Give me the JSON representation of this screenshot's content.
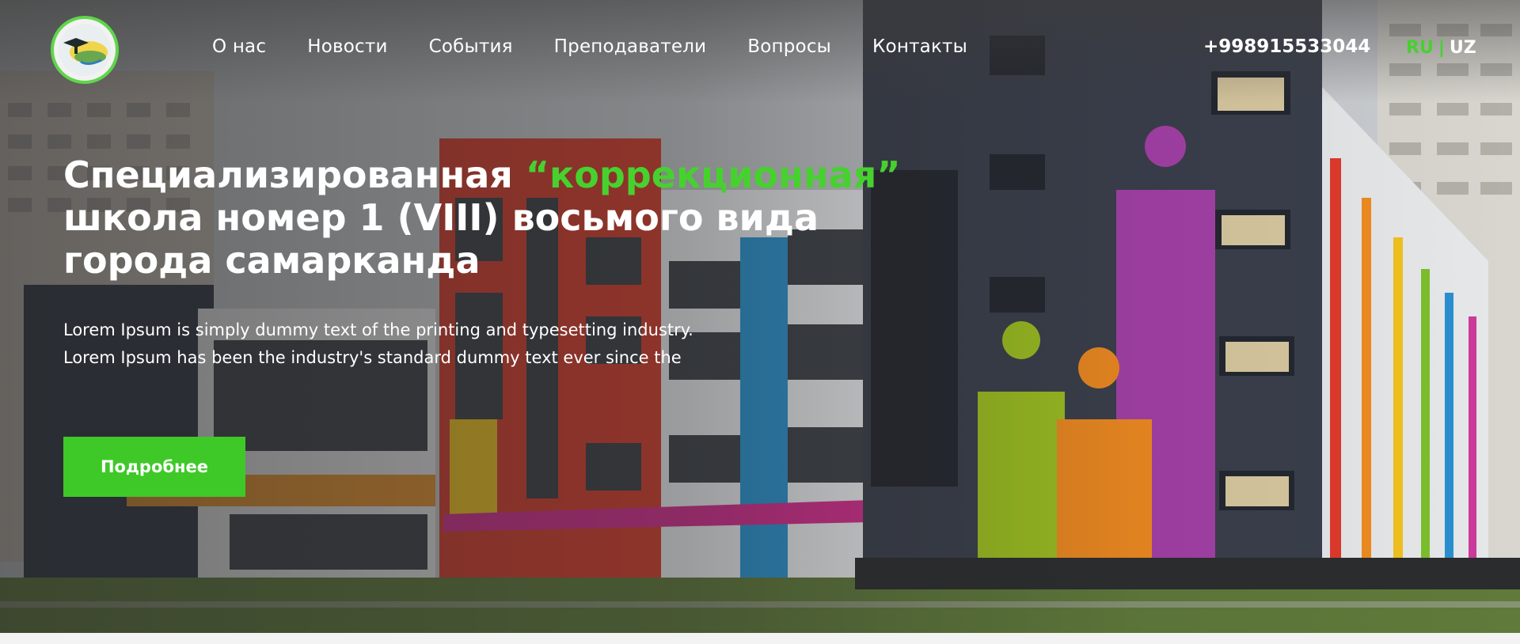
{
  "header": {
    "nav": [
      "О нас",
      "Новости",
      "События",
      "Преподаватели",
      "Вопросы",
      "Контакты"
    ],
    "phone": "+998915533044",
    "lang": {
      "ru": "RU",
      "sep": "|",
      "uz": "UZ"
    }
  },
  "hero": {
    "title_part1": "Специализированная ",
    "title_accent": "“коррекционная”",
    "title_part2": "школа номер 1 (VIII) восьмого вида города самарканда",
    "description": "Lorem Ipsum is simply dummy text of the printing and typesetting industry. Lorem Ipsum has been the industry's standard dummy text ever since the",
    "button_label": "Подробнее"
  },
  "colors": {
    "accent": "#47d12f",
    "button": "#3ec928",
    "text": "#ffffff"
  }
}
